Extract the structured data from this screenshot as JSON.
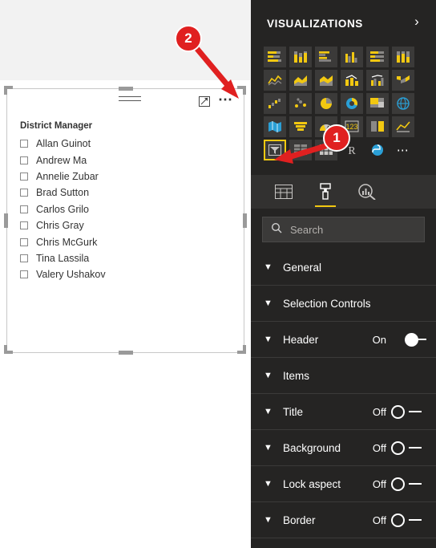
{
  "canvas": {
    "slicer": {
      "title": "District Manager",
      "header_icons": [
        "hamburger-filter-icon",
        "focus-mode-icon",
        "more-options-icon"
      ],
      "items": [
        "Allan Guinot",
        "Andrew Ma",
        "Annelie Zubar",
        "Brad Sutton",
        "Carlos Grilo",
        "Chris Gray",
        "Chris McGurk",
        "Tina Lassila",
        "Valery Ushakov"
      ]
    }
  },
  "panel": {
    "title": "VISUALIZATIONS",
    "expand_icon": "›",
    "gallery": {
      "rows": [
        [
          "stacked-bar-chart-icon",
          "stacked-column-chart-icon",
          "clustered-bar-chart-icon",
          "clustered-column-chart-icon",
          "hundred-percent-stacked-bar-chart-icon",
          "hundred-percent-stacked-column-chart-icon"
        ],
        [
          "line-chart-icon",
          "area-chart-icon",
          "stacked-area-chart-icon",
          "line-stacked-column-chart-icon",
          "line-clustered-column-chart-icon",
          "ribbon-chart-icon"
        ],
        [
          "waterfall-chart-icon",
          "scatter-chart-icon",
          "pie-chart-icon",
          "donut-chart-icon",
          "treemap-icon",
          "map-icon"
        ],
        [
          "filled-map-icon",
          "funnel-icon",
          "gauge-icon",
          "card-icon",
          "multi-row-card-icon",
          "kpi-icon"
        ],
        [
          "slicer-icon",
          "table-icon",
          "matrix-icon",
          "r-script-visual-icon",
          "python-visual-icon",
          "more-visuals-icon"
        ]
      ],
      "selected": "slicer-icon"
    },
    "field_tabs": [
      {
        "name": "fields-tab",
        "icon": "fields-grid-icon",
        "active": false
      },
      {
        "name": "format-tab",
        "icon": "paint-roller-icon",
        "active": true
      },
      {
        "name": "analytics-tab",
        "icon": "magnifier-chart-icon",
        "active": false
      }
    ],
    "search": {
      "placeholder": "Search",
      "value": "",
      "icon": "search-icon"
    },
    "format_sections": [
      {
        "label": "General",
        "state": null,
        "toggle": null
      },
      {
        "label": "Selection Controls",
        "state": null,
        "toggle": null
      },
      {
        "label": "Header",
        "state": "On",
        "toggle": "on"
      },
      {
        "label": "Items",
        "state": null,
        "toggle": null
      },
      {
        "label": "Title",
        "state": "Off",
        "toggle": "off"
      },
      {
        "label": "Background",
        "state": "Off",
        "toggle": "off"
      },
      {
        "label": "Lock aspect",
        "state": "Off",
        "toggle": "off"
      },
      {
        "label": "Border",
        "state": "Off",
        "toggle": "off"
      }
    ]
  },
  "annotations": {
    "badge_1": "1",
    "badge_2": "2"
  },
  "colors": {
    "panel_bg": "#252423",
    "accent_yellow": "#f2c811",
    "annotation_red": "#e02020",
    "canvas_gray": "#f2f2f2"
  }
}
